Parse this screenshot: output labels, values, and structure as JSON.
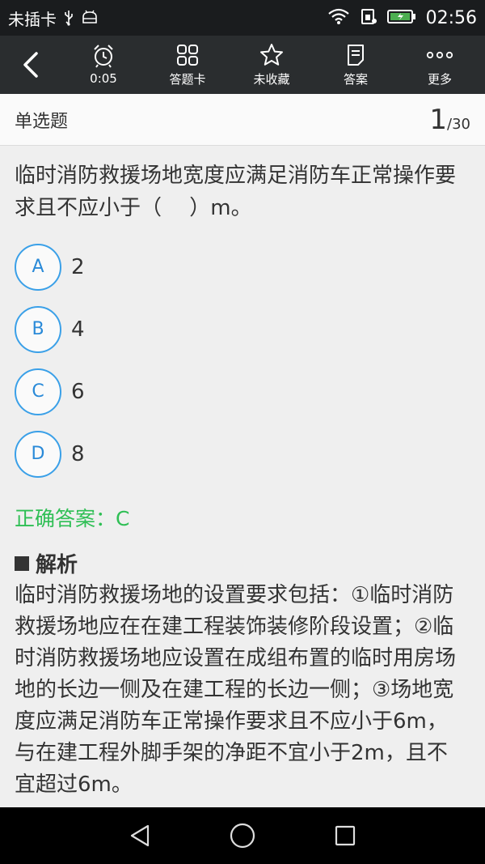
{
  "status_bar": {
    "carrier": "未插卡",
    "time": "02:56"
  },
  "toolbar": {
    "timer_label": "0:05",
    "answer_card_label": "答题卡",
    "favorite_label": "未收藏",
    "answer_label": "答案",
    "more_label": "更多"
  },
  "header": {
    "question_type": "单选题",
    "current": "1",
    "total": "/30"
  },
  "question": {
    "text": "临时消防救援场地宽度应满足消防车正常操作要求且不应小于（　 ）m。",
    "options": [
      {
        "letter": "A",
        "text": "2"
      },
      {
        "letter": "B",
        "text": "4"
      },
      {
        "letter": "C",
        "text": "6"
      },
      {
        "letter": "D",
        "text": "8"
      }
    ],
    "correct_answer": "正确答案：C"
  },
  "analysis": {
    "title": "解析",
    "text": "临时消防救援场地的设置要求包括：①临时消防救援场地应在在建工程装饰装修阶段设置；②临时消防救援场地应设置在成组布置的临时用房场地的长边一侧及在建工程的长边一侧；③场地宽度应满足消防车正常操作要求且不应小于6m，与在建工程外脚手架的净距不宜小于2m，且不宜超过6m。"
  },
  "colors": {
    "toolbar_bg": "#2a2d2f",
    "accent_blue": "#3aa0e8",
    "correct_green": "#2fbf55"
  }
}
